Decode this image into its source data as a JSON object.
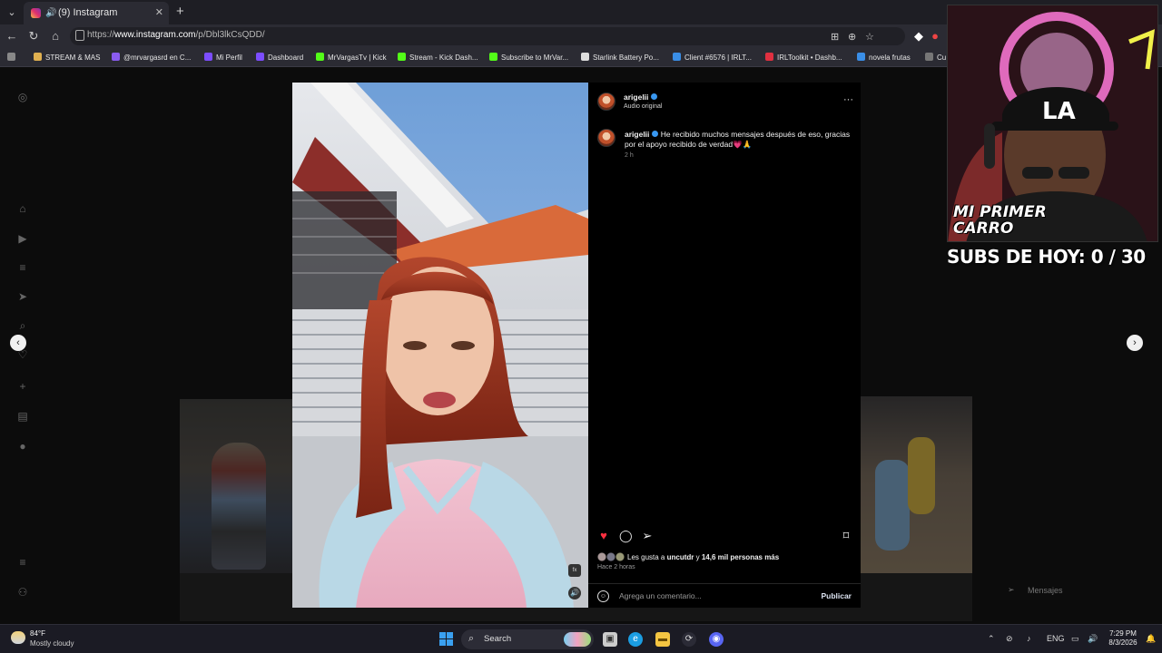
{
  "browser": {
    "tab_title": "(9) Instagram",
    "url_prefix": "https://",
    "url_host": "www.instagram.com",
    "url_path": "/p/Dbl3lkCsQDD/",
    "bookmarks": [
      "STREAM & MAS",
      "@mrvargasrd en C...",
      "Mi Perfil",
      "Dashboard",
      "MrVargasTv | Kick",
      "Stream - Kick Dash...",
      "Subscribe to MrVar...",
      "Starlink Battery Po...",
      "Client #6576 | IRLT...",
      "IRLToolkit • Dashb...",
      "novela frutas",
      "Cu"
    ]
  },
  "post": {
    "username": "arigelii",
    "audio": "Audio original",
    "caption": "He recibido muchos mensajes después de eso, gracias por el apoyo recibido de verdad💗🙏",
    "caption_time": "2 h",
    "likes_prefix": "Les gusta a ",
    "likes_user": "uncutdr",
    "likes_mid": " y ",
    "likes_count": "14,6 mil personas más",
    "posted_ago": "Hace 2 horas",
    "comment_placeholder": "Agrega un comentario...",
    "publish_label": "Publicar"
  },
  "overlay": {
    "subs_text": "SUBS DE HOY: 0 / 30",
    "webcam_banner": "MI PRIMER CARRO"
  },
  "messages_label": "Mensajes",
  "taskbar": {
    "temperature": "84°F",
    "condition": "Mostly cloudy",
    "search_label": "Search",
    "language": "ENG",
    "time": "7:29 PM",
    "date": "8/3/2026"
  }
}
